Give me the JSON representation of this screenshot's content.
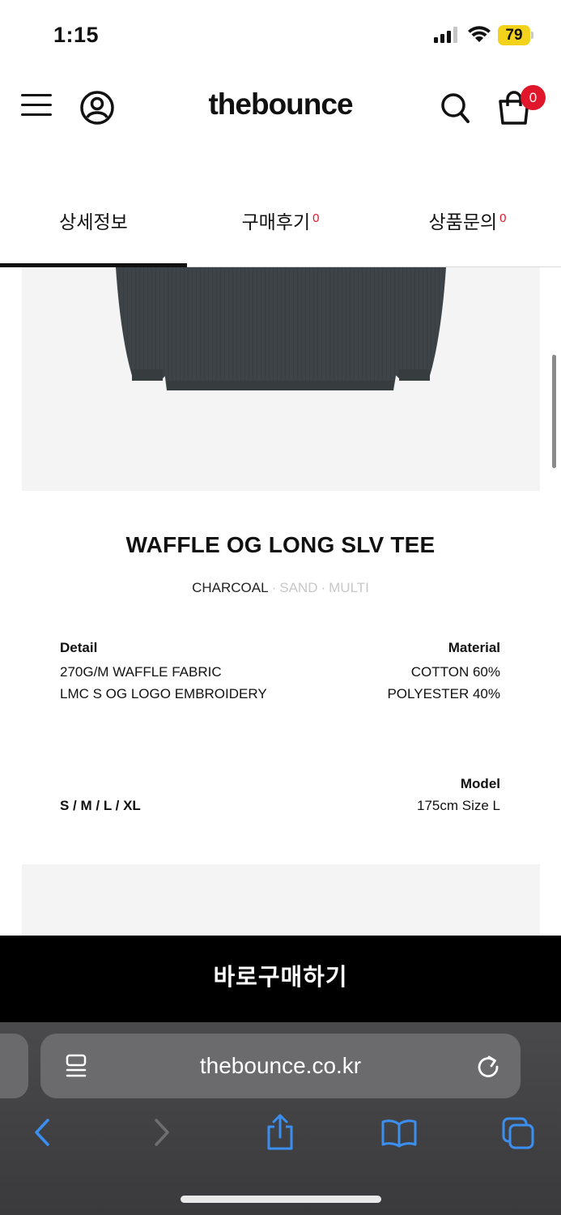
{
  "status": {
    "time": "1:15",
    "battery": "79"
  },
  "header": {
    "logo": "thebounce",
    "cart_count": "0"
  },
  "tabs": [
    {
      "label": "상세정보",
      "count": ""
    },
    {
      "label": "구매후기",
      "count": "0"
    },
    {
      "label": "상품문의",
      "count": "0"
    }
  ],
  "product": {
    "title": "WAFFLE OG LONG SLV TEE",
    "colors": [
      "CHARCOAL",
      "SAND",
      "MULTI"
    ],
    "detail_heading": "Detail",
    "detail_lines": [
      "270G/M  WAFFLE FABRIC",
      "LMC S OG LOGO EMBROIDERY"
    ],
    "material_heading": "Material",
    "material_lines": [
      "COTTON 60%",
      "POLYESTER 40%"
    ],
    "sizes": "S / M / L / XL",
    "model_heading": "Model",
    "model_value": "175cm Size L"
  },
  "buy_button": "바로구매하기",
  "browser": {
    "url": "thebounce.co.kr"
  },
  "colors": {
    "accent_red": "#e0162b",
    "battery_yellow": "#f2d21a",
    "shirt": "#3d4346"
  }
}
